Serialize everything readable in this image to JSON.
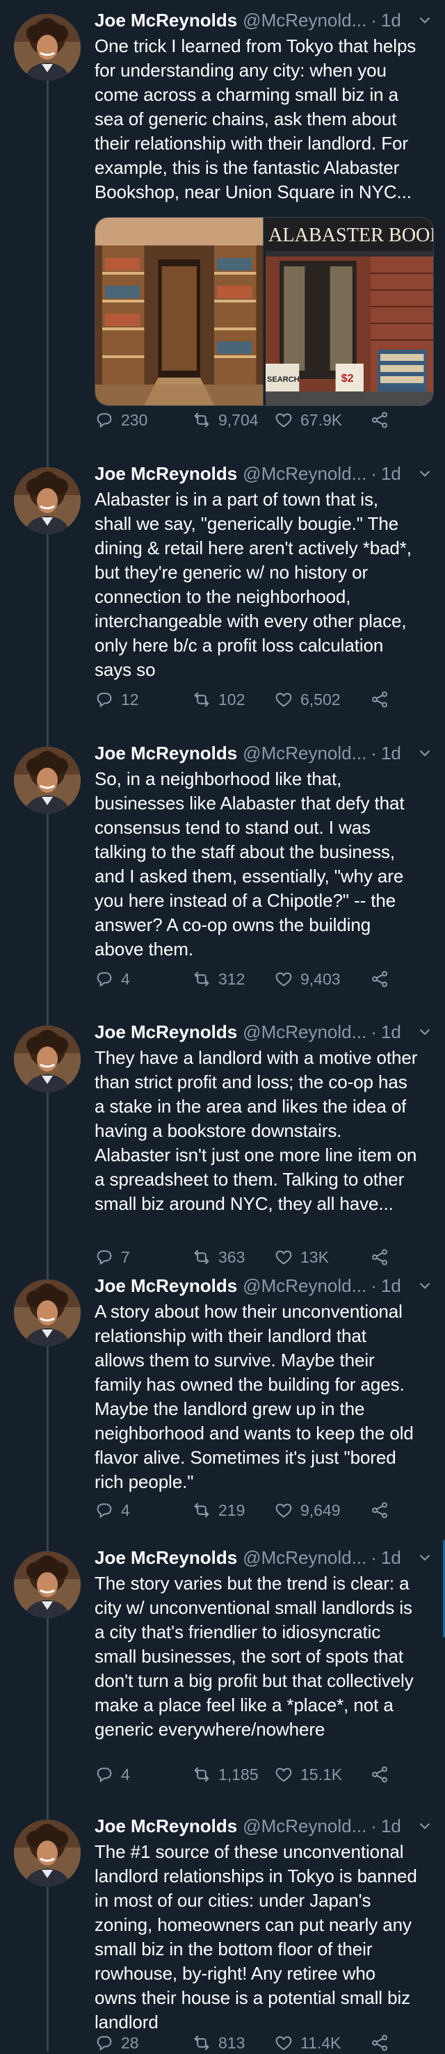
{
  "author": {
    "name": "Joe McReynolds",
    "handle": "@McReynold...",
    "separator": "·"
  },
  "storefront": {
    "sign": "ALABASTER BOOKS",
    "cart_sign": "$2",
    "search_sign": "SEARCH"
  },
  "colors": {
    "background": "#15202b",
    "muted": "#8899a6",
    "line": "#38444d",
    "accent": "#1d9bf0"
  },
  "icons": {
    "reply": "reply-icon",
    "retweet": "retweet-icon",
    "like": "heart-icon",
    "share": "share-icon",
    "menu": "chevron-down-icon"
  },
  "tweets": [
    {
      "time": "1d",
      "text": "One trick I learned from Tokyo that helps\nfor understanding any city: when you\ncome across a charming small biz in a\nsea of generic chains, ask them about\ntheir relationship with their landlord. For\nexample, this is the fantastic Alabaster\nBookshop, near Union Square in NYC...",
      "replies": "230",
      "retweets": "9,704",
      "likes": "67.9K"
    },
    {
      "time": "1d",
      "text": "Alabaster is in a part of town that is,\nshall we say, \"generically bougie.\" The\ndining & retail here aren't actively *bad*,\nbut they're generic w/ no history or\nconnection to the neighborhood,\ninterchangeable with every other place,\nonly here b/c a profit loss calculation\nsays so",
      "replies": "12",
      "retweets": "102",
      "likes": "6,502"
    },
    {
      "time": "1d",
      "text": "So, in a neighborhood like that,\nbusinesses like Alabaster that defy that\nconsensus tend to stand out. I was\ntalking to the staff about the business,\nand I asked them, essentially, \"why are\nyou here instead of a Chipotle?\" -- the\nanswer? A co-op owns the building\nabove them.",
      "replies": "4",
      "retweets": "312",
      "likes": "9,403"
    },
    {
      "time": "1d",
      "text": "They have a landlord with a motive other\nthan strict profit and loss; the co-op has\na stake in the area and likes the idea of\nhaving a bookstore downstairs.\nAlabaster isn't just one more line item on\na spreadsheet to them. Talking to other\nsmall biz around NYC, they all have...",
      "replies": "7",
      "retweets": "363",
      "likes": "13K"
    },
    {
      "time": "1d",
      "text": "A story about how their unconventional\nrelationship with their landlord that\nallows them to survive. Maybe their\nfamily has owned the building for ages.\nMaybe the landlord grew up in the\nneighborhood and wants to keep the old\nflavor alive. Sometimes it's just \"bored\nrich people.\"",
      "replies": "4",
      "retweets": "219",
      "likes": "9,649"
    },
    {
      "time": "1d",
      "text": "The story varies but the trend is clear: a\ncity w/ unconventional small landlords is\na city that's friendlier to idiosyncratic\nsmall businesses, the sort of spots that\ndon't turn a big profit but that collectively\nmake a place feel like a *place*, not a\ngeneric everywhere/nowhere",
      "replies": "4",
      "retweets": "1,185",
      "likes": "15.1K"
    },
    {
      "time": "1d",
      "text": "The #1 source of these unconventional\nlandlord relationships in Tokyo is banned\nin most of our cities: under Japan's\nzoning, homeowners can put nearly any\nsmall biz in the bottom floor of their\nrowhouse, by-right! Any retiree who\nowns their house is a potential small biz\nlandlord",
      "replies": "28",
      "retweets": "813",
      "likes": "11.4K"
    }
  ]
}
